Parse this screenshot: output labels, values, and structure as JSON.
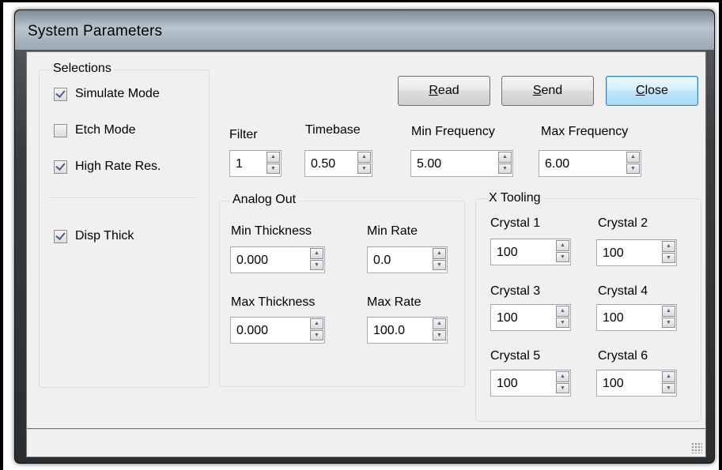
{
  "window": {
    "title": "System Parameters"
  },
  "selections": {
    "label": "Selections",
    "items": [
      {
        "label": "Simulate Mode",
        "checked": true
      },
      {
        "label": "Etch Mode",
        "checked": false
      },
      {
        "label": "High Rate Res.",
        "checked": true
      }
    ],
    "disp_thick": {
      "label": "Disp Thick",
      "checked": true
    }
  },
  "buttons": {
    "read": {
      "pre": "",
      "accel": "R",
      "post": "ead"
    },
    "send": {
      "pre": "",
      "accel": "S",
      "post": "end"
    },
    "close": {
      "pre": "",
      "accel": "C",
      "post": "lose"
    }
  },
  "fields": {
    "filter": {
      "label": "Filter",
      "value": "1"
    },
    "timebase": {
      "label": "Timebase",
      "value": "0.50"
    },
    "min_frequency": {
      "label": "Min Frequency",
      "value": "5.00"
    },
    "max_frequency": {
      "label": "Max Frequency",
      "value": "6.00"
    }
  },
  "analog_out": {
    "label": "Analog Out",
    "min_thickness": {
      "label": "Min Thickness",
      "value": "0.000"
    },
    "min_rate": {
      "label": "Min Rate",
      "value": "0.0"
    },
    "max_thickness": {
      "label": "Max Thickness",
      "value": "0.000"
    },
    "max_rate": {
      "label": "Max Rate",
      "value": "100.0"
    }
  },
  "x_tooling": {
    "label": "X Tooling",
    "crystals": [
      {
        "label": "Crystal 1",
        "value": "100"
      },
      {
        "label": "Crystal 2",
        "value": "100"
      },
      {
        "label": "Crystal 3",
        "value": "100"
      },
      {
        "label": "Crystal 4",
        "value": "100"
      },
      {
        "label": "Crystal 5",
        "value": "100"
      },
      {
        "label": "Crystal 6",
        "value": "100"
      }
    ]
  },
  "icons": [
    "spin-up-icon",
    "spin-down-icon",
    "checkmark-icon",
    "resize-grip-icon"
  ],
  "colors": {
    "title_bar": "#b9c6cf",
    "dialog_bg": "#f0f0f0",
    "default_button": "#bee6fd",
    "check": "#4a5d8a"
  }
}
